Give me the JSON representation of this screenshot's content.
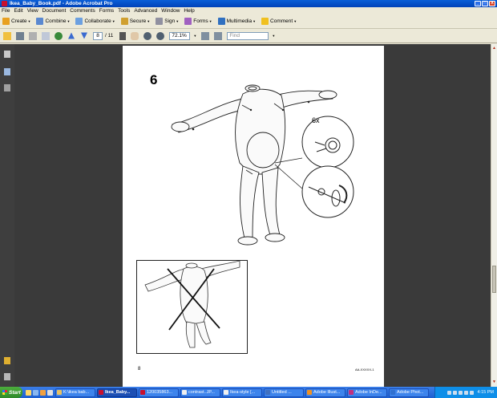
{
  "window": {
    "title": "Ikea_Baby_Book.pdf - Adobe Acrobat Pro",
    "controls": [
      "_",
      "□",
      "X"
    ]
  },
  "menu": [
    "File",
    "Edit",
    "View",
    "Document",
    "Comments",
    "Forms",
    "Tools",
    "Advanced",
    "Window",
    "Help"
  ],
  "toolbar": {
    "create": "Create",
    "combine": "Combine",
    "collaborate": "Collaborate",
    "secure": "Secure",
    "sign": "Sign",
    "forms": "Forms",
    "multimedia": "Multimedia",
    "comment": "Comment"
  },
  "nav": {
    "page_current": "8",
    "page_total": "/ 11",
    "zoom": "72.1%",
    "find_placeholder": "Find"
  },
  "document": {
    "step_number": "6",
    "callout_count": "6x",
    "page_number": "8",
    "doc_code": "AA-XXXXX-1"
  },
  "taskbar": {
    "start": "Start",
    "tasks": [
      {
        "label": "K:\\ikea bab...",
        "color": "#e8c060"
      },
      {
        "label": "Ikea_Baby...",
        "color": "#c8102e",
        "active": true
      },
      {
        "label": "120035863...",
        "color": "#c8102e"
      },
      {
        "label": "contrast..JP...",
        "color": "#f0f0f0"
      },
      {
        "label": "Ikea-style [...",
        "color": "#f0f0f0"
      },
      {
        "label": "Untitled ...",
        "color": "#4070c0"
      },
      {
        "label": "Adobe Illust...",
        "color": "#f09020"
      },
      {
        "label": "Adobe InDe...",
        "color": "#c03080"
      },
      {
        "label": "Adobe Phot...",
        "color": "#3070d0"
      }
    ],
    "clock": "4:15 PM"
  }
}
